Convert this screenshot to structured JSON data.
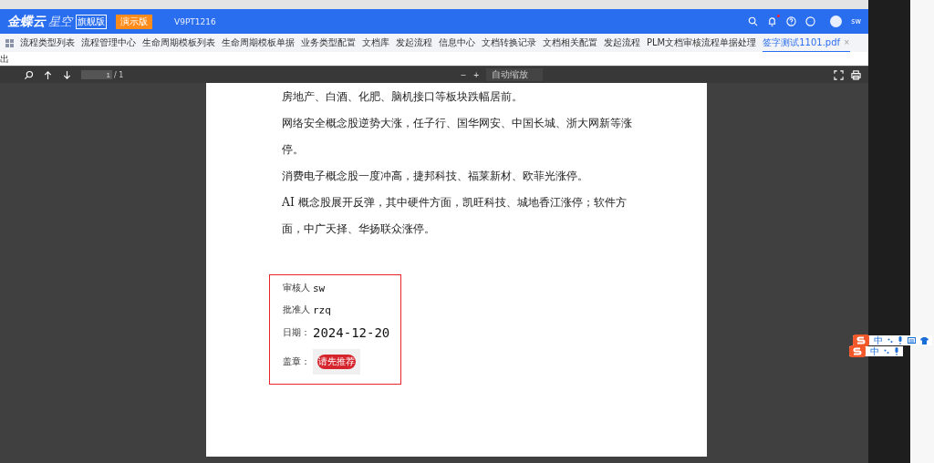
{
  "header": {
    "brand": "金蝶云",
    "brand_sub": "星空",
    "edition_badge": "旗舰版",
    "demo_badge": "演示版",
    "tenant": "V9PT1216",
    "notification_dot": true,
    "user": "sw"
  },
  "tabs": [
    {
      "label": "流程类型列表",
      "selected": false
    },
    {
      "label": "流程管理中心",
      "selected": false
    },
    {
      "label": "生命周期模板列表",
      "selected": false
    },
    {
      "label": "生命周期模板单据",
      "selected": false
    },
    {
      "label": "业务类型配置",
      "selected": false
    },
    {
      "label": "文档库",
      "selected": false
    },
    {
      "label": "发起流程",
      "selected": false
    },
    {
      "label": "信息中心",
      "selected": false
    },
    {
      "label": "文档转换记录",
      "selected": false
    },
    {
      "label": "文档相关配置",
      "selected": false
    },
    {
      "label": "发起流程",
      "selected": false
    },
    {
      "label": "PLM文档审核流程单据处理",
      "selected": false
    },
    {
      "label": "签字测试1101.pdf",
      "selected": true,
      "closable": true,
      "close_label": "×"
    }
  ],
  "sub_row": {
    "text": "出"
  },
  "pdf_toolbar": {
    "page_input": "1",
    "page_total": "/ 1",
    "zoom_out": "−",
    "zoom_in": "+",
    "zoom_select": "自动缩放"
  },
  "document": {
    "paragraphs": [
      "房地产、白酒、化肥、脑机接口等板块跌幅居前。",
      "网络安全概念股逆势大涨，任子行、国华网安、中国长城、浙大网新等涨停。",
      "消费电子概念股一度冲高，捷邦科技、福莱新材、欧菲光涨停。",
      "AI 概念股展开反弹，其中硬件方面，凯旺科技、城地香江涨停；软件方面，中广天择、华扬联众涨停。"
    ],
    "approval": [
      {
        "kind": "text",
        "label": "审核人",
        "value": "sw"
      },
      {
        "kind": "text",
        "label": "批准人",
        "value": "rzq"
      },
      {
        "kind": "text",
        "label": "日期：",
        "value": "2024-12-20"
      },
      {
        "kind": "seal",
        "label": "盖章：",
        "value": "请先推荐"
      }
    ]
  },
  "ime_toolbars": [
    {
      "label": "中"
    },
    {
      "label": "中"
    }
  ]
}
